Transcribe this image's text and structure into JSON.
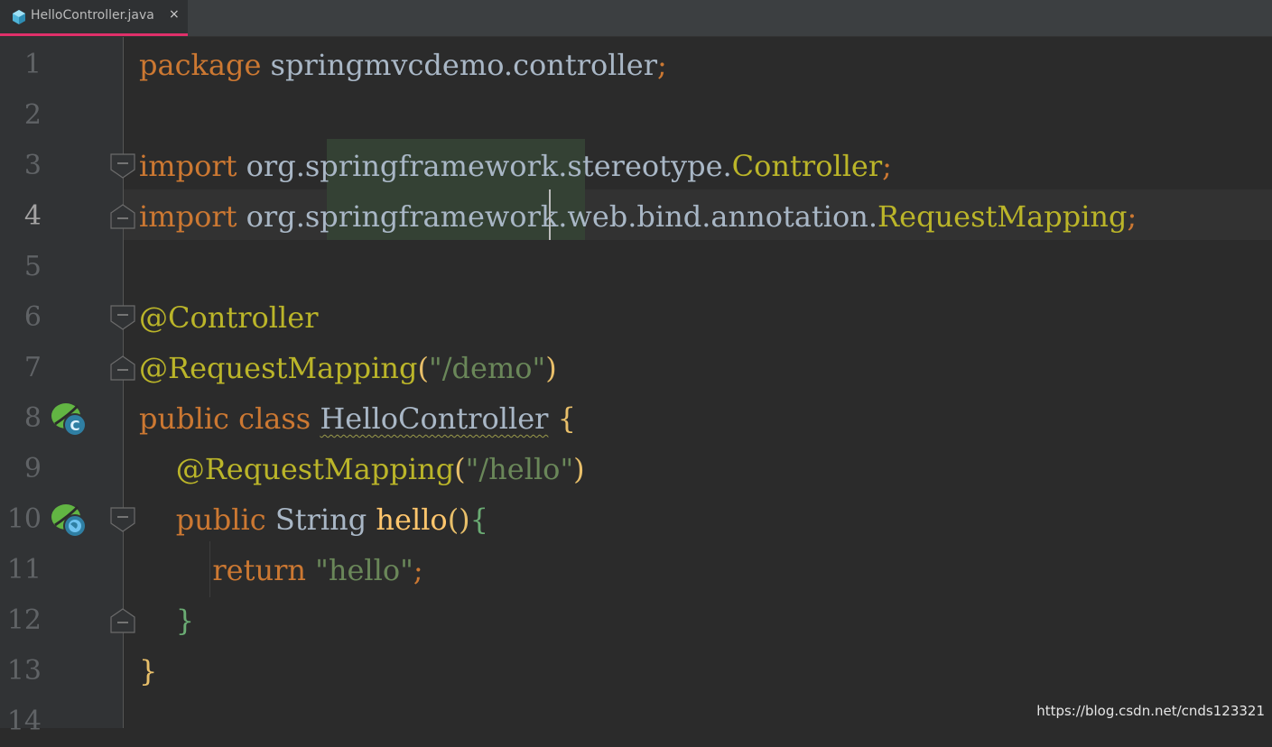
{
  "tab": {
    "title": "HelloController.java",
    "icon": "java-class-icon",
    "close_label": "×",
    "active_underline_color": "#e0306a"
  },
  "editor": {
    "current_line": 4,
    "line_numbers": [
      "1",
      "2",
      "3",
      "4",
      "5",
      "6",
      "7",
      "8",
      "9",
      "10",
      "11",
      "12",
      "13",
      "14"
    ],
    "lines": [
      {
        "n": 1,
        "tokens": [
          {
            "t": "package",
            "c": "kw"
          },
          {
            "t": " springmvcdemo.controller",
            "c": "cls"
          },
          {
            "t": ";",
            "c": "semi"
          }
        ]
      },
      {
        "n": 2,
        "tokens": []
      },
      {
        "n": 3,
        "tokens": [
          {
            "t": "import",
            "c": "kw"
          },
          {
            "t": " org.springframework.stereotype.",
            "c": "cls"
          },
          {
            "t": "Controller",
            "c": "pkgtype"
          },
          {
            "t": ";",
            "c": "semi"
          }
        ]
      },
      {
        "n": 4,
        "tokens": [
          {
            "t": "import",
            "c": "kw"
          },
          {
            "t": " org.springframework.web.bind.annotation.",
            "c": "cls"
          },
          {
            "t": "RequestMapping",
            "c": "pkgtype"
          },
          {
            "t": ";",
            "c": "semi"
          }
        ]
      },
      {
        "n": 5,
        "tokens": []
      },
      {
        "n": 6,
        "tokens": [
          {
            "t": "@Controller",
            "c": "ann"
          }
        ]
      },
      {
        "n": 7,
        "tokens": [
          {
            "t": "@RequestMapping",
            "c": "ann"
          },
          {
            "t": "(",
            "c": "paren"
          },
          {
            "t": "\"/demo\"",
            "c": "str"
          },
          {
            "t": ")",
            "c": "paren"
          }
        ]
      },
      {
        "n": 8,
        "tokens": [
          {
            "t": "public class ",
            "c": "kw"
          },
          {
            "t": "HelloController",
            "c": "cls wavy"
          },
          {
            "t": " ",
            "c": "cls"
          },
          {
            "t": "{",
            "c": "brace1"
          }
        ]
      },
      {
        "n": 9,
        "tokens": [
          {
            "t": "    ",
            "c": "cls"
          },
          {
            "t": "@RequestMapping",
            "c": "ann"
          },
          {
            "t": "(",
            "c": "paren"
          },
          {
            "t": "\"/hello\"",
            "c": "str"
          },
          {
            "t": ")",
            "c": "paren"
          }
        ]
      },
      {
        "n": 10,
        "tokens": [
          {
            "t": "    ",
            "c": "cls"
          },
          {
            "t": "public ",
            "c": "kw"
          },
          {
            "t": "String ",
            "c": "cls"
          },
          {
            "t": "hello",
            "c": "method"
          },
          {
            "t": "()",
            "c": "paren"
          },
          {
            "t": "{",
            "c": "brace2"
          }
        ]
      },
      {
        "n": 11,
        "tokens": [
          {
            "t": "        ",
            "c": "cls"
          },
          {
            "t": "return ",
            "c": "kw"
          },
          {
            "t": "\"hello\"",
            "c": "str"
          },
          {
            "t": ";",
            "c": "semi"
          }
        ]
      },
      {
        "n": 12,
        "tokens": [
          {
            "t": "    ",
            "c": "cls"
          },
          {
            "t": "}",
            "c": "brace2"
          }
        ]
      },
      {
        "n": 13,
        "tokens": [
          {
            "t": "}",
            "c": "brace1"
          }
        ]
      }
    ],
    "gutter_icons": [
      {
        "line": 8,
        "name": "spring-bean-class-icon",
        "badge": "C"
      },
      {
        "line": 10,
        "name": "spring-request-mapping-icon",
        "badge": "globe"
      }
    ],
    "fold_markers": [
      {
        "line": 3,
        "kind": "open"
      },
      {
        "line": 4,
        "kind": "close"
      },
      {
        "line": 6,
        "kind": "open"
      },
      {
        "line": 7,
        "kind": "close"
      },
      {
        "line": 10,
        "kind": "open"
      },
      {
        "line": 12,
        "kind": "close"
      }
    ]
  },
  "watermark": "https://blog.csdn.net/cnds123321",
  "colors": {
    "background": "#2b2b2b",
    "gutter": "#313335",
    "keyword": "#cc7832",
    "annotation": "#bbb529",
    "string": "#6a8759",
    "identifier": "#a9b7c6",
    "method": "#ffc66d"
  }
}
